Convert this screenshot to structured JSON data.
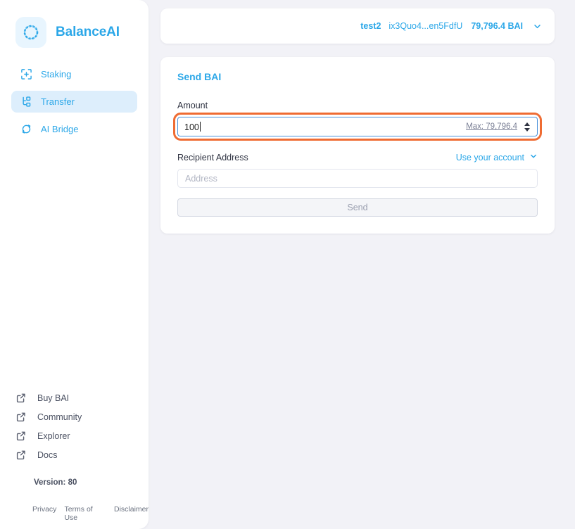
{
  "brand": {
    "name": "BalanceAI",
    "logo_icon": "dotted-ring-logo-icon",
    "accent": "#2ba7e8"
  },
  "sidebar": {
    "nav": [
      {
        "label": "Staking",
        "icon": "staking-plus-frame-icon",
        "active": false
      },
      {
        "label": "Transfer",
        "icon": "transfer-nodes-icon",
        "active": true
      },
      {
        "label": "AI Bridge",
        "icon": "bridge-refresh-icon",
        "active": false
      }
    ],
    "external_links": [
      {
        "label": "Buy BAI",
        "icon": "external-link-icon"
      },
      {
        "label": "Community",
        "icon": "external-link-icon"
      },
      {
        "label": "Explorer",
        "icon": "external-link-icon"
      },
      {
        "label": "Docs",
        "icon": "external-link-icon"
      }
    ],
    "version": "Version: 80",
    "legal": [
      "Privacy",
      "Terms of Use",
      "Disclaimer"
    ]
  },
  "header": {
    "account_name": "test2",
    "account_address": "ix3Quo4...en5FdfU",
    "balance": "79,796.4 BAI",
    "chevron_icon": "chevron-down-icon"
  },
  "send": {
    "title": "Send BAI",
    "amount_label": "Amount",
    "amount_value": "100",
    "max_label": "Max: 79,796.4",
    "stepper_icon": "spinner-arrows-icon",
    "recipient_label": "Recipient Address",
    "use_account_label": "Use your account",
    "use_account_chevron": "chevron-down-icon",
    "address_placeholder": "Address",
    "address_value": "",
    "send_button_label": "Send",
    "highlight_color": "#ef6c33",
    "focus_border_color": "#4a90d9"
  }
}
